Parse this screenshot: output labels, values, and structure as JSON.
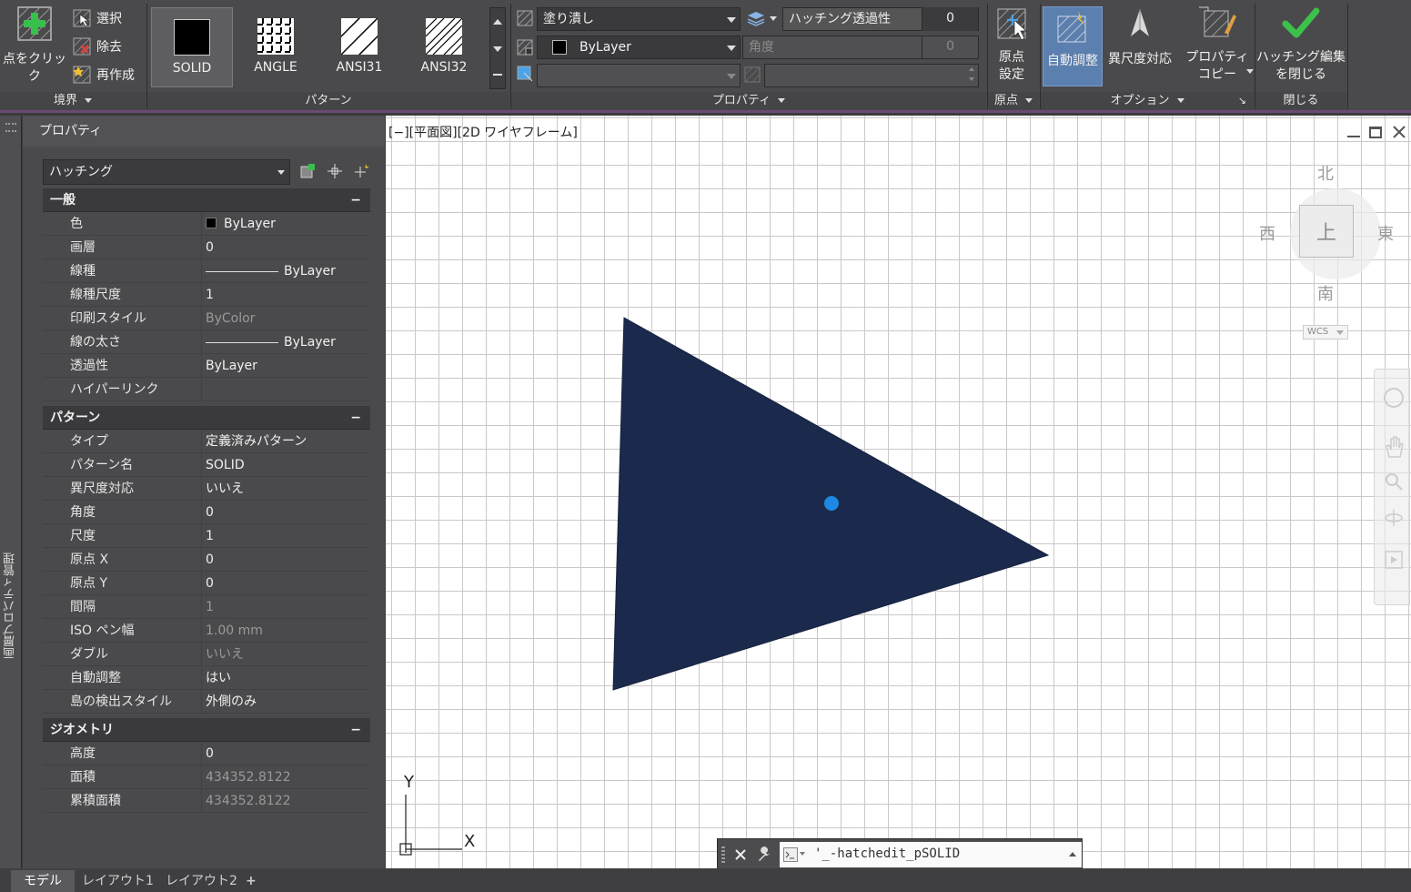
{
  "ribbon": {
    "boundary": {
      "pick_points_label": "点をクリック",
      "select_label": "選択",
      "remove_label": "除去",
      "recreate_label": "再作成",
      "title": "境界"
    },
    "pattern": {
      "title": "パターン",
      "tiles": [
        "SOLID",
        "ANGLE",
        "ANSI31",
        "ANSI32"
      ]
    },
    "properties": {
      "title": "プロパティ",
      "hatch_type": "塗り潰し",
      "color": "ByLayer",
      "background": "",
      "transparency_label": "ハッチング透過性",
      "transparency_value": "0",
      "angle_label": "角度",
      "angle_value": "0"
    },
    "origin": {
      "title": "原点",
      "set_origin_label": "原点\n設定"
    },
    "options": {
      "title": "オプション",
      "associative_label": "自動調整",
      "annotative_label": "異尺度対応",
      "match_properties_label": "プロパティ\nコピー"
    },
    "close": {
      "title": "閉じる",
      "close_label": "ハッチング編集\nを閉じる"
    }
  },
  "palette": {
    "side_title": "画層プロパティ管理",
    "header": "プロパティ",
    "object_type": "ハッチング",
    "sections": [
      {
        "title": "一般",
        "rows": [
          {
            "k": "色",
            "v": "ByLayer",
            "swatch": true
          },
          {
            "k": "画層",
            "v": "0"
          },
          {
            "k": "線種",
            "v": "ByLayer",
            "line": true
          },
          {
            "k": "線種尺度",
            "v": "1"
          },
          {
            "k": "印刷スタイル",
            "v": "ByColor",
            "dim": true
          },
          {
            "k": "線の太さ",
            "v": "ByLayer",
            "line": true
          },
          {
            "k": "透過性",
            "v": "ByLayer"
          },
          {
            "k": "ハイパーリンク",
            "v": ""
          }
        ]
      },
      {
        "title": "パターン",
        "rows": [
          {
            "k": "タイプ",
            "v": "定義済みパターン"
          },
          {
            "k": "パターン名",
            "v": "SOLID"
          },
          {
            "k": "異尺度対応",
            "v": "いいえ"
          },
          {
            "k": "角度",
            "v": "0"
          },
          {
            "k": "尺度",
            "v": "1"
          },
          {
            "k": "原点 X",
            "v": "0"
          },
          {
            "k": "原点 Y",
            "v": "0"
          },
          {
            "k": "間隔",
            "v": "1",
            "dim": true
          },
          {
            "k": "ISO ペン幅",
            "v": "1.00 mm",
            "dim": true
          },
          {
            "k": "ダブル",
            "v": "いいえ",
            "dim": true
          },
          {
            "k": "自動調整",
            "v": "はい"
          },
          {
            "k": "島の検出スタイル",
            "v": "外側のみ"
          }
        ]
      },
      {
        "title": "ジオメトリ",
        "rows": [
          {
            "k": "高度",
            "v": "0"
          },
          {
            "k": "面積",
            "v": "434352.8122",
            "dim": true
          },
          {
            "k": "累積面積",
            "v": "434352.8122",
            "dim": true
          }
        ]
      }
    ]
  },
  "viewport": {
    "label": "[−][平面図][2D ワイヤフレーム]",
    "viewcube": {
      "north": "北",
      "south": "南",
      "east": "東",
      "west": "西",
      "top": "上",
      "wcs": "WCS"
    },
    "ucs": {
      "x": "X",
      "y": "Y"
    },
    "command_text": "'_-hatchedit_pSOLID",
    "fill_color": "#1b2a4c",
    "grip_color": "#1e88e5"
  },
  "tabs": [
    "モデル",
    "レイアウト1",
    "レイアウト2",
    "+"
  ]
}
